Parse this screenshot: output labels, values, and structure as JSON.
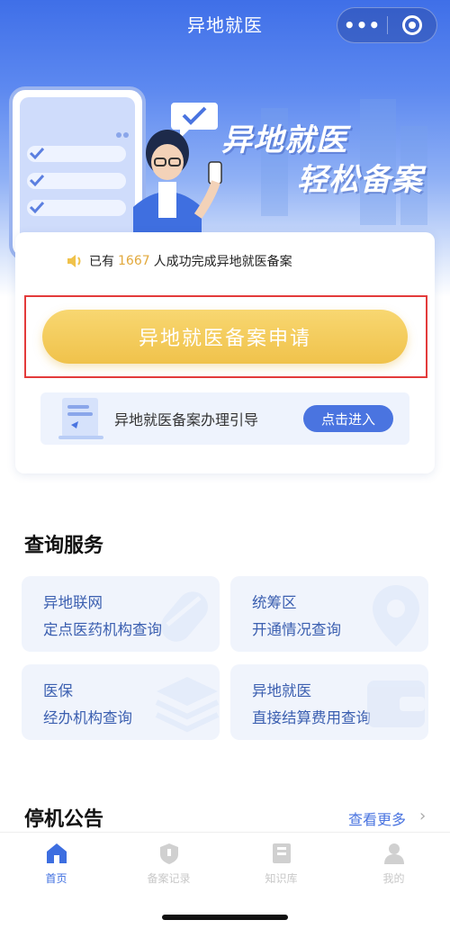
{
  "nav": {
    "title": "异地就医",
    "more_glyph": "•••"
  },
  "hero": {
    "slogan_line1": "异地就医",
    "slogan_line2": "轻松备案"
  },
  "notice": {
    "prefix": "已有",
    "count": "1667",
    "suffix": "人成功完成异地就医备案"
  },
  "apply_button": "异地就医备案申请",
  "guide": {
    "text": "异地就医备案办理引导",
    "enter_label": "点击进入"
  },
  "query": {
    "title": "查询服务",
    "tiles": [
      {
        "line1": "异地联网",
        "line2": "定点医药机构查询",
        "icon": "pill-icon"
      },
      {
        "line1": "统筹区",
        "line2": "开通情况查询",
        "icon": "location-pin-icon"
      },
      {
        "line1": "医保",
        "line2": "经办机构查询",
        "icon": "layers-icon"
      },
      {
        "line1": "异地就医",
        "line2": "直接结算费用查询",
        "icon": "wallet-icon"
      }
    ]
  },
  "announcement": {
    "title": "停机公告",
    "more_label": "查看更多",
    "arrow": "›"
  },
  "tabbar": [
    {
      "label": "首页",
      "icon": "home-icon",
      "active": true
    },
    {
      "label": "备案记录",
      "icon": "record-shield-icon",
      "active": false
    },
    {
      "label": "知识库",
      "icon": "book-icon",
      "active": false
    },
    {
      "label": "我的",
      "icon": "user-icon",
      "active": false
    }
  ],
  "colors": {
    "brand_blue": "#4a74e0",
    "gold": "#f0c24b",
    "highlight_red": "#e33b3b"
  }
}
